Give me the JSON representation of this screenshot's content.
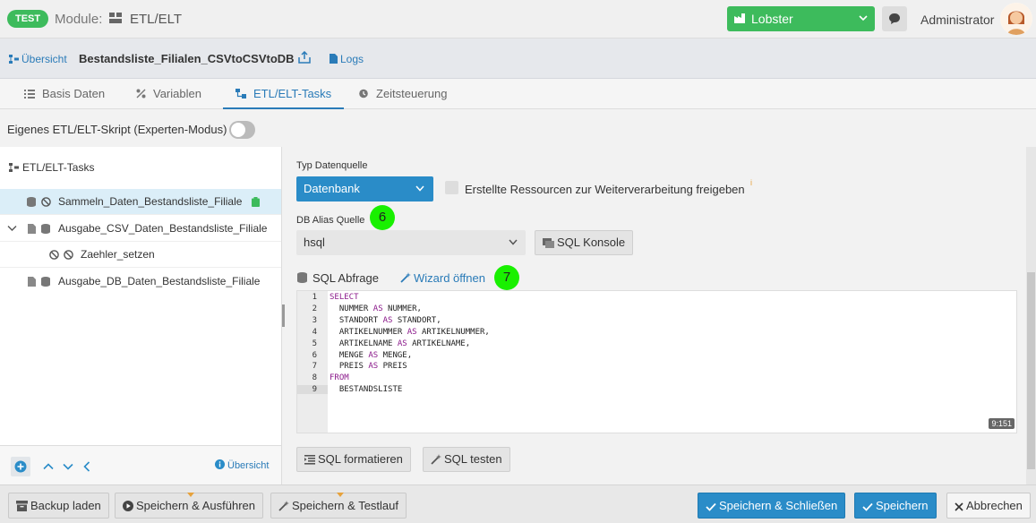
{
  "header": {
    "badge": "TEST",
    "module_label": "Module:",
    "module_name": "ETL/ELT",
    "tenant": "Lobster",
    "user": "Administrator"
  },
  "subbar": {
    "overview": "Übersicht",
    "title": "Bestandsliste_Filialen_CSVtoCSVtoDB",
    "logs": "Logs"
  },
  "tabs": [
    {
      "label": "Basis Daten"
    },
    {
      "label": "Variablen"
    },
    {
      "label": "ETL/ELT-Tasks"
    },
    {
      "label": "Zeitsteuerung"
    }
  ],
  "expert_mode_label": "Eigenes ETL/ELT-Skript (Experten-Modus)",
  "tree": {
    "header": "ETL/ELT-Tasks",
    "items": [
      {
        "label": "Sammeln_Daten_Bestandsliste_Filiale"
      },
      {
        "label": "Ausgabe_CSV_Daten_Bestandsliste_Filiale"
      },
      {
        "label": "Zaehler_setzen"
      },
      {
        "label": "Ausgabe_DB_Daten_Bestandsliste_Filiale"
      }
    ],
    "footer_overview": "Übersicht"
  },
  "form": {
    "type_label": "Typ Datenquelle",
    "type_value": "Datenbank",
    "checkbox_label": "Erstellte Ressourcen zur Weiterverarbeitung freigeben",
    "info_mark": "i",
    "alias_label": "DB Alias Quelle",
    "alias_value": "hsql",
    "sql_console": "SQL Konsole",
    "sql_label": "SQL Abfrage",
    "wizard": "Wizard öffnen",
    "bubble_6": "6",
    "bubble_7": "7",
    "format_btn": "SQL formatieren",
    "test_btn": "SQL testen"
  },
  "editor": {
    "lines": [
      {
        "n": "1",
        "kw": "SELECT",
        "text": ""
      },
      {
        "n": "2",
        "text": "  NUMMER ",
        "kw": "AS",
        "rest": " NUMMER,"
      },
      {
        "n": "3",
        "text": "  STANDORT ",
        "kw": "AS",
        "rest": " STANDORT,"
      },
      {
        "n": "4",
        "text": "  ARTIKELNUMMER ",
        "kw": "AS",
        "rest": " ARTIKELNUMMER,"
      },
      {
        "n": "5",
        "text": "  ARTIKELNAME ",
        "kw": "AS",
        "rest": " ARTIKELNAME,"
      },
      {
        "n": "6",
        "text": "  MENGE ",
        "kw": "AS",
        "rest": " MENGE,"
      },
      {
        "n": "7",
        "text": "  PREIS ",
        "kw": "AS",
        "rest": " PREIS"
      },
      {
        "n": "8",
        "kw": "FROM",
        "text": ""
      },
      {
        "n": "9",
        "text": "  BESTANDSLISTE",
        "kw": ""
      }
    ],
    "cursor": "9:151"
  },
  "footer": {
    "backup": "Backup laden",
    "save_run": "Speichern & Ausführen",
    "save_test": "Speichern & Testlauf",
    "save_close": "Speichern & Schließen",
    "save": "Speichern",
    "cancel": "Abbrechen"
  },
  "colors": {
    "green": "#3dbb5c",
    "blue": "#2a8cc8",
    "bubble": "#19f000",
    "link": "#2a7bb8"
  }
}
